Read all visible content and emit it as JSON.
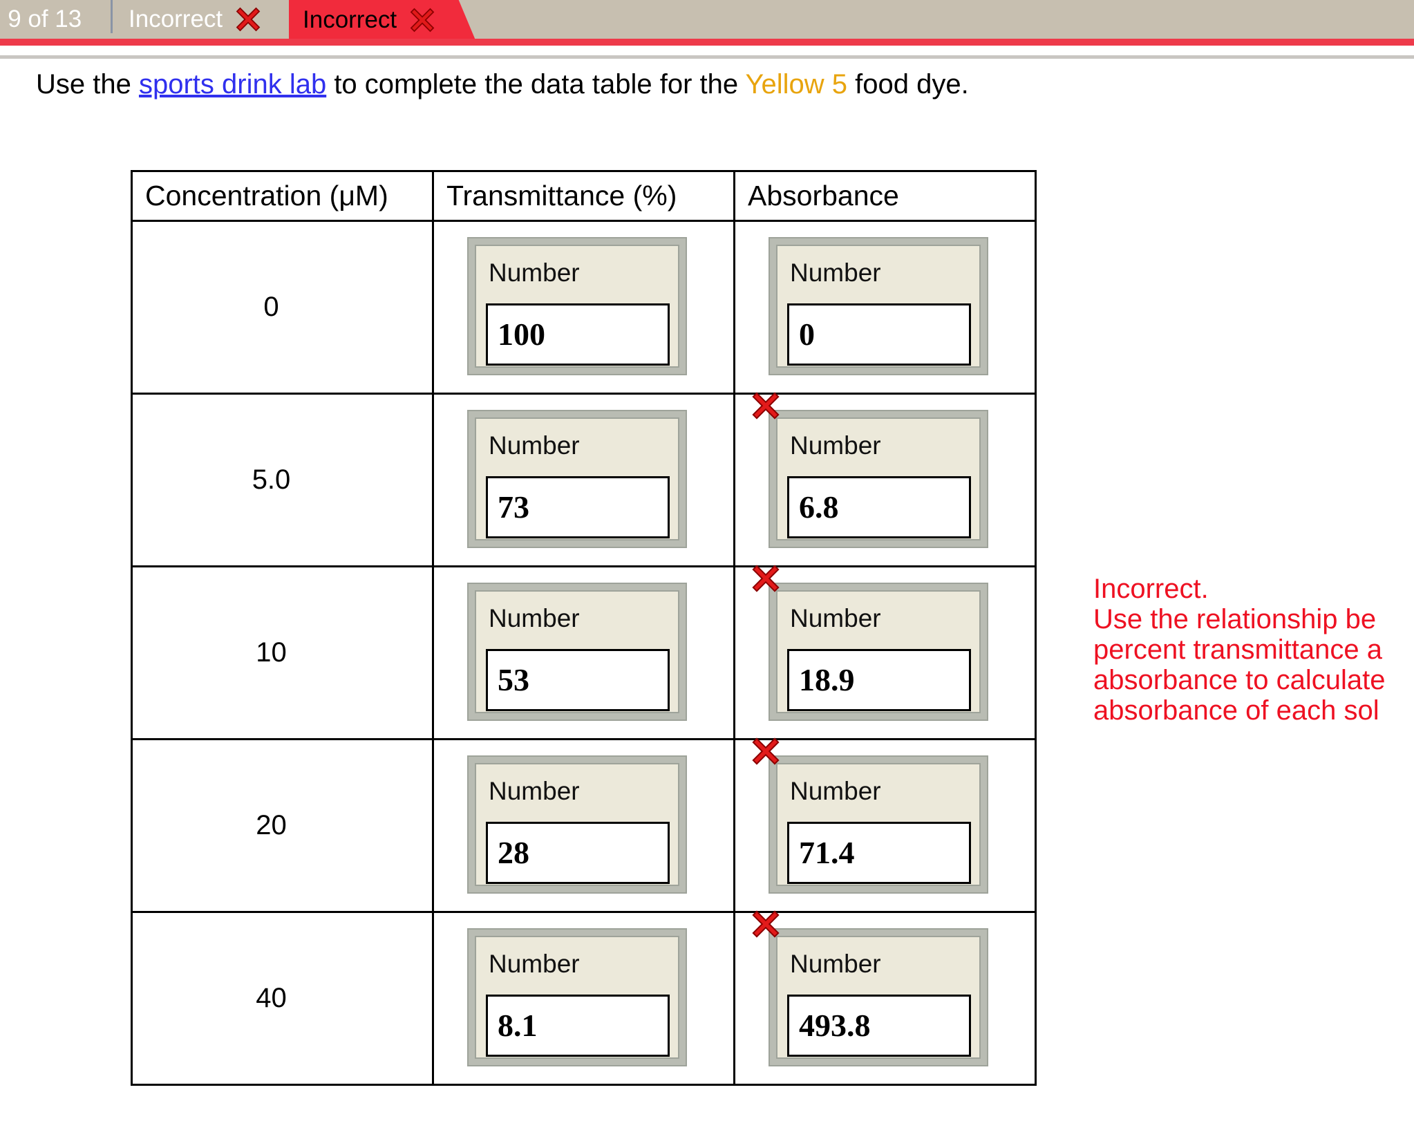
{
  "tabs": {
    "counter": "n 9 of 13",
    "previous_label": "Incorrect",
    "active_label": "Incorrect"
  },
  "instructions": {
    "prefix": "Use the ",
    "link": "sports drink lab",
    "middle": " to complete the data table for the ",
    "dye": "Yellow 5",
    "suffix": " food dye."
  },
  "table": {
    "headers": [
      "Concentration (μM)",
      "Transmittance (%)",
      "Absorbance"
    ],
    "field_label": "Number",
    "rows": [
      {
        "concentration": "0",
        "transmittance": "100",
        "absorbance": "0",
        "absorbance_incorrect": false
      },
      {
        "concentration": "5.0",
        "transmittance": "73",
        "absorbance": "6.8",
        "absorbance_incorrect": true
      },
      {
        "concentration": "10",
        "transmittance": "53",
        "absorbance": "18.9",
        "absorbance_incorrect": true
      },
      {
        "concentration": "20",
        "transmittance": "28",
        "absorbance": "71.4",
        "absorbance_incorrect": true
      },
      {
        "concentration": "40",
        "transmittance": "8.1",
        "absorbance": "493.8",
        "absorbance_incorrect": true
      }
    ]
  },
  "feedback": {
    "title": "Incorrect.",
    "lines": [
      "Use the relationship be",
      "percent transmittance a",
      "absorbance to calculate",
      "absorbance of each sol"
    ]
  },
  "colors": {
    "active_tab": "#f12b3c",
    "error_text": "#ee1122",
    "link": "#3030ee",
    "dye_text": "#e8a40e",
    "input_frame": "#ece9da"
  }
}
